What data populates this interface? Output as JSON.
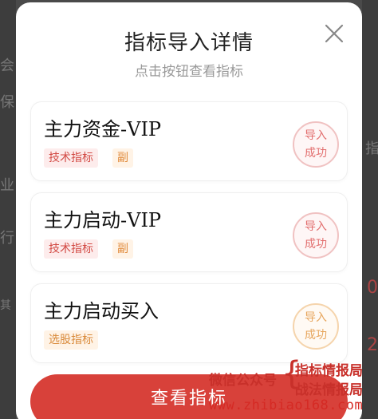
{
  "background": {
    "fragments": [
      "会",
      "保",
      "业",
      "行",
      "其",
      "指",
      "0",
      "2"
    ]
  },
  "modal": {
    "title": "指标导入详情",
    "subtitle": "点击按钮查看指标",
    "close_icon": "close-icon",
    "items": [
      {
        "title": "主力资金-VIP",
        "tags": [
          "技术指标",
          "副"
        ],
        "status_line1": "导入",
        "status_line2": "成功",
        "status_color": "red"
      },
      {
        "title": "主力启动-VIP",
        "tags": [
          "技术指标",
          "副"
        ],
        "status_line1": "导入",
        "status_line2": "成功",
        "status_color": "red"
      },
      {
        "title": "主力启动买入",
        "tags": [
          "选股指标"
        ],
        "status_line1": "导入",
        "status_line2": "成功",
        "status_color": "orange"
      }
    ],
    "button_label": "查看指标"
  },
  "watermark": {
    "wechat": "微信公众号",
    "line1": "指标情报局",
    "line2": "战法情报局",
    "url": "www.zhibiao168.com"
  },
  "colors": {
    "accent": "#d8413a",
    "tag_red_bg": "#fdecec",
    "tag_orange_bg": "#fff3e6"
  }
}
